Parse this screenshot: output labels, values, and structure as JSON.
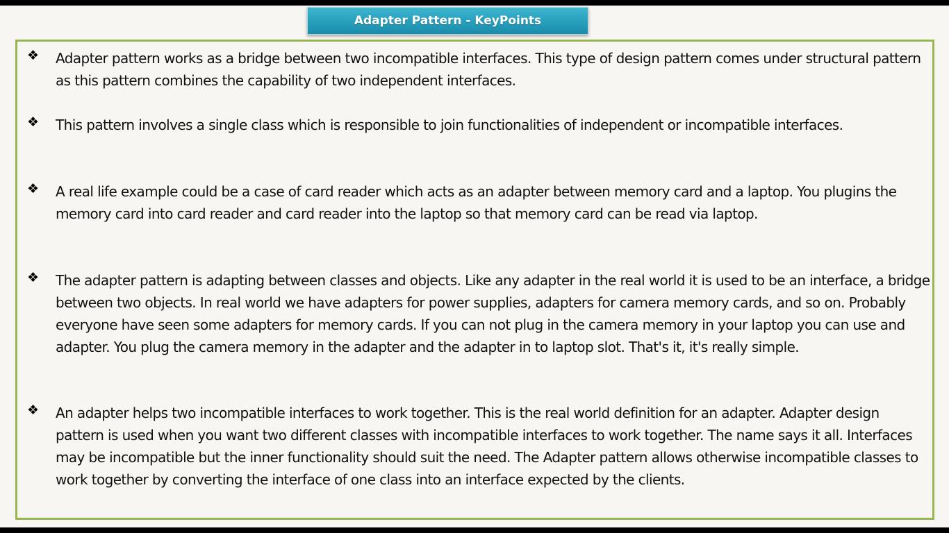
{
  "slide": {
    "title": "Adapter Pattern - KeyPoints",
    "bullet_glyph": "❖",
    "points": [
      "Adapter pattern works as a bridge between two incompatible interfaces. This type of design pattern comes under structural pattern as this pattern combines the capability of two independent interfaces.",
      "This pattern involves a single class which is responsible to join functionalities of independent or incompatible interfaces.",
      "A real life example could be a case of card reader which acts as an adapter between memory card and a laptop. You plugins the memory card into card reader and card reader into the laptop so that memory card can be read via laptop.",
      "The adapter pattern is adapting between classes and objects. Like any adapter in the real world it is used to be an interface, a bridge between two objects. In real world we have adapters for power supplies, adapters for camera memory cards, and so on. Probably everyone have seen some adapters for memory cards. If you can not plug in the camera memory in your laptop you can use and adapter. You plug the camera memory in the adapter and the adapter in to laptop slot. That's it, it's really simple.",
      "An adapter helps two incompatible interfaces to work together. This is the real world definition for an adapter. Adapter design pattern is used when you want two different classes with incompatible interfaces to work together. The name says it all. Interfaces may be incompatible but the inner functionality should suit the need. The Adapter pattern allows otherwise incompatible classes to work together by converting the interface of one class into an interface expected by the clients."
    ]
  },
  "colors": {
    "banner": "#2aa3c0",
    "border": "#97b64f",
    "background": "#f7f6f3"
  }
}
